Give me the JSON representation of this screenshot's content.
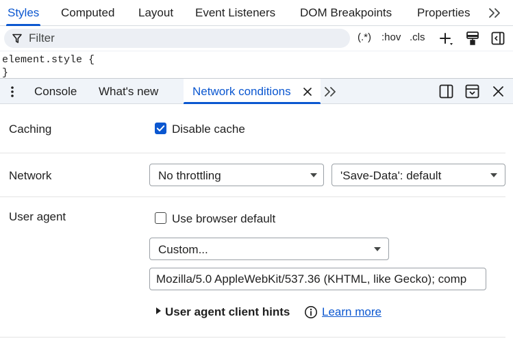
{
  "top_tabs": {
    "items": [
      {
        "label": "Styles",
        "active": true
      },
      {
        "label": "Computed",
        "active": false
      },
      {
        "label": "Layout",
        "active": false
      },
      {
        "label": "Event Listeners",
        "active": false
      },
      {
        "label": "DOM Breakpoints",
        "active": false
      },
      {
        "label": "Properties",
        "active": false
      }
    ],
    "more_icon": "chevrons-right-icon"
  },
  "filter_bar": {
    "placeholder": "Filter",
    "toggle_regex": "(.*)",
    "hov": ":hov",
    "cls": ".cls",
    "icons": [
      "filter-icon",
      "new-style-rule-icon",
      "rendering-emulations-icon",
      "toggle-sidebar-icon"
    ]
  },
  "styles": {
    "element_style": "element.style {",
    "closing_brace": "}"
  },
  "drawer": {
    "tabs": [
      {
        "label": "Console",
        "active": false
      },
      {
        "label": "What's new",
        "active": false
      },
      {
        "label": "Network conditions",
        "active": true,
        "closable": true
      }
    ],
    "icons": [
      "menu-dots-icon",
      "close-tab-icon",
      "more-tabs-icon",
      "dock-side-icon",
      "undock-drawer-icon",
      "close-drawer-icon"
    ]
  },
  "network_conditions": {
    "caching": {
      "label": "Caching",
      "checkbox_label": "Disable cache",
      "checked": true
    },
    "network": {
      "label": "Network",
      "throttling_value": "No throttling",
      "save_data_value": "'Save-Data': default"
    },
    "user_agent": {
      "label": "User agent",
      "checkbox_label": "Use browser default",
      "checked": false,
      "preset_value": "Custom...",
      "ua_string": "Mozilla/5.0 AppleWebKit/537.36 (KHTML, like Gecko); comp",
      "hints_label": "User agent client hints",
      "learn_more": "Learn more"
    }
  },
  "colors": {
    "accent": "#0b57d0",
    "drawer_background": "#f0f4f9",
    "filter_background": "#eceff4",
    "text": "#1f1f1f"
  }
}
